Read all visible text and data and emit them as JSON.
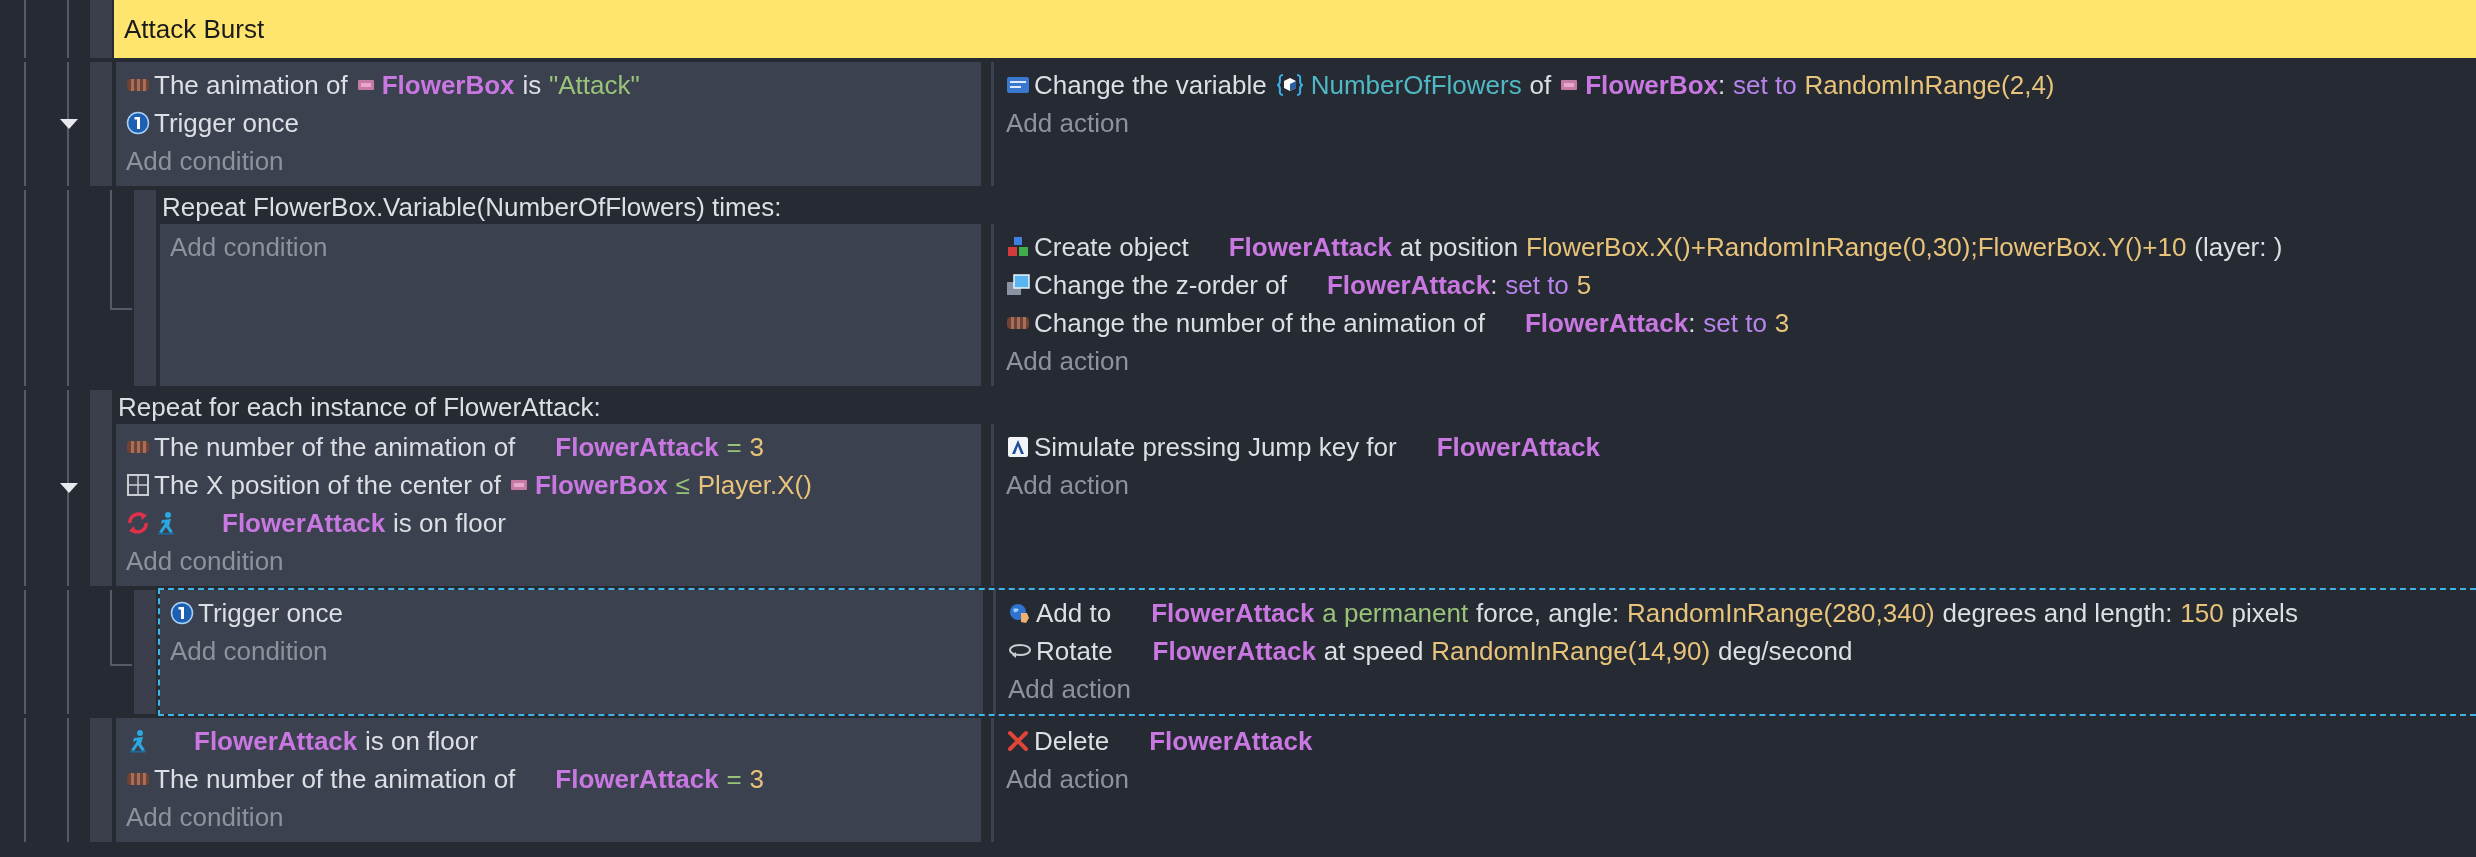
{
  "events": [
    {
      "kind": "group",
      "title": "Attack Burst"
    },
    {
      "kind": "standard",
      "selected": false,
      "expanded": true,
      "conditions": [
        {
          "kind": "animation",
          "inverted": false,
          "runs": [
            {
              "kind": "plain",
              "parts": [
                {
                  "kind": "text",
                  "text": "The animation of"
                }
              ]
            },
            {
              "kind": "thumbnail",
              "parts": [
                {
                  "kind": "object",
                  "text": "FlowerBox"
                },
                {
                  "kind": "text",
                  "text": "is"
                },
                {
                  "kind": "string",
                  "text": "\"Attack\""
                }
              ]
            }
          ]
        },
        {
          "kind": "trigger-once",
          "inverted": false,
          "runs": [
            {
              "kind": "plain",
              "parts": [
                {
                  "kind": "text",
                  "text": "Trigger once"
                }
              ]
            }
          ]
        }
      ],
      "add_condition": "Add condition",
      "actions": [
        {
          "kind": "variable",
          "runs": [
            {
              "kind": "plain",
              "parts": [
                {
                  "kind": "text",
                  "text": "Change the variable"
                }
              ]
            },
            {
              "kind": "variable",
              "parts": [
                {
                  "kind": "variable",
                  "text": "NumberOfFlowers"
                },
                {
                  "kind": "text",
                  "text": "of"
                }
              ]
            },
            {
              "kind": "thumbnail",
              "parts": [
                {
                  "kind": "object",
                  "text": "FlowerBox"
                },
                {
                  "kind": "text",
                  "text": ":",
                  "tight": true
                },
                {
                  "kind": "operator",
                  "text": "set to"
                },
                {
                  "kind": "expression",
                  "text": "RandomInRange(2,4)"
                }
              ]
            }
          ]
        }
      ],
      "add_action": "Add action",
      "children": [
        {
          "kind": "repeat",
          "header": "Repeat FlowerBox.Variable(NumberOfFlowers) times:",
          "selected": false,
          "add_condition": "Add condition",
          "actions": [
            {
              "kind": "create",
              "runs": [
                {
                  "kind": "plain",
                  "parts": [
                    {
                      "kind": "text",
                      "text": "Create object"
                    }
                  ]
                },
                {
                  "kind": "blank",
                  "parts": [
                    {
                      "kind": "object",
                      "text": "FlowerAttack"
                    },
                    {
                      "kind": "text",
                      "text": "at position"
                    },
                    {
                      "kind": "expression",
                      "text": "FlowerBox.X()+RandomInRange(0,30);FlowerBox.Y()+10"
                    },
                    {
                      "kind": "text",
                      "text": "(layer: )"
                    }
                  ]
                }
              ]
            },
            {
              "kind": "z-order",
              "runs": [
                {
                  "kind": "plain",
                  "parts": [
                    {
                      "kind": "text",
                      "text": "Change the z-order of"
                    }
                  ]
                },
                {
                  "kind": "blank",
                  "parts": [
                    {
                      "kind": "object",
                      "text": "FlowerAttack"
                    },
                    {
                      "kind": "text",
                      "text": ":",
                      "tight": true
                    },
                    {
                      "kind": "operator",
                      "text": "set to"
                    },
                    {
                      "kind": "expression",
                      "text": "5"
                    }
                  ]
                }
              ]
            },
            {
              "kind": "animation",
              "runs": [
                {
                  "kind": "plain",
                  "parts": [
                    {
                      "kind": "text",
                      "text": "Change the number of the animation of"
                    }
                  ]
                },
                {
                  "kind": "blank",
                  "parts": [
                    {
                      "kind": "object",
                      "text": "FlowerAttack"
                    },
                    {
                      "kind": "text",
                      "text": ":",
                      "tight": true
                    },
                    {
                      "kind": "operator",
                      "text": "set to"
                    },
                    {
                      "kind": "expression",
                      "text": "3"
                    }
                  ]
                }
              ]
            }
          ],
          "add_action": "Add action"
        }
      ]
    },
    {
      "kind": "for_each",
      "header": "Repeat for each instance of FlowerAttack:",
      "selected": false,
      "expanded": true,
      "conditions": [
        {
          "kind": "animation",
          "inverted": false,
          "runs": [
            {
              "kind": "plain",
              "parts": [
                {
                  "kind": "text",
                  "text": "The number of the animation of"
                }
              ]
            },
            {
              "kind": "blank",
              "parts": [
                {
                  "kind": "object",
                  "text": "FlowerAttack"
                },
                {
                  "kind": "comparison",
                  "text": "="
                },
                {
                  "kind": "expression",
                  "text": "3"
                }
              ]
            }
          ]
        },
        {
          "kind": "position",
          "inverted": false,
          "runs": [
            {
              "kind": "plain",
              "parts": [
                {
                  "kind": "text",
                  "text": "The X position of the center of"
                }
              ]
            },
            {
              "kind": "thumbnail",
              "parts": [
                {
                  "kind": "object",
                  "text": "FlowerBox"
                },
                {
                  "kind": "comparison",
                  "text": "≤"
                },
                {
                  "kind": "expression",
                  "text": "Player.X()"
                }
              ]
            }
          ]
        },
        {
          "kind": "platformer",
          "inverted": true,
          "runs": [
            {
              "kind": "blank",
              "parts": [
                {
                  "kind": "object",
                  "text": "FlowerAttack"
                },
                {
                  "kind": "text",
                  "text": "is on floor"
                }
              ]
            }
          ]
        }
      ],
      "add_condition": "Add condition",
      "actions": [
        {
          "kind": "jump-key",
          "runs": [
            {
              "kind": "plain",
              "parts": [
                {
                  "kind": "text",
                  "text": "Simulate pressing Jump key for"
                }
              ]
            },
            {
              "kind": "blank",
              "parts": [
                {
                  "kind": "object",
                  "text": "FlowerAttack"
                }
              ]
            }
          ]
        }
      ],
      "add_action": "Add action",
      "children": [
        {
          "kind": "standard",
          "selected": true,
          "conditions": [
            {
              "kind": "trigger-once",
              "inverted": false,
              "runs": [
                {
                  "kind": "plain",
                  "parts": [
                    {
                      "kind": "text",
                      "text": "Trigger once"
                    }
                  ]
                }
              ]
            }
          ],
          "add_condition": "Add condition",
          "actions": [
            {
              "kind": "force",
              "runs": [
                {
                  "kind": "plain",
                  "parts": [
                    {
                      "kind": "text",
                      "text": "Add to"
                    }
                  ]
                },
                {
                  "kind": "blank",
                  "parts": [
                    {
                      "kind": "object",
                      "text": "FlowerAttack"
                    },
                    {
                      "kind": "choice",
                      "text": "a permanent"
                    },
                    {
                      "kind": "text",
                      "text": "force, angle:"
                    },
                    {
                      "kind": "expression",
                      "text": "RandomInRange(280,340)"
                    },
                    {
                      "kind": "text",
                      "text": "degrees and length:"
                    },
                    {
                      "kind": "expression",
                      "text": "150"
                    },
                    {
                      "kind": "text",
                      "text": "pixels"
                    }
                  ]
                }
              ]
            },
            {
              "kind": "rotate",
              "runs": [
                {
                  "kind": "plain",
                  "parts": [
                    {
                      "kind": "text",
                      "text": "Rotate"
                    }
                  ]
                },
                {
                  "kind": "blank",
                  "parts": [
                    {
                      "kind": "object",
                      "text": "FlowerAttack"
                    },
                    {
                      "kind": "text",
                      "text": "at speed"
                    },
                    {
                      "kind": "expression",
                      "text": "RandomInRange(14,90)"
                    },
                    {
                      "kind": "text",
                      "text": "deg/second"
                    }
                  ]
                }
              ]
            }
          ],
          "add_action": "Add action"
        }
      ]
    },
    {
      "kind": "standard",
      "selected": false,
      "conditions": [
        {
          "kind": "platformer",
          "inverted": false,
          "runs": [
            {
              "kind": "blank",
              "parts": [
                {
                  "kind": "object",
                  "text": "FlowerAttack"
                },
                {
                  "kind": "text",
                  "text": "is on floor"
                }
              ]
            }
          ]
        },
        {
          "kind": "animation",
          "inverted": false,
          "runs": [
            {
              "kind": "plain",
              "parts": [
                {
                  "kind": "text",
                  "text": "The number of the animation of"
                }
              ]
            },
            {
              "kind": "blank",
              "parts": [
                {
                  "kind": "object",
                  "text": "FlowerAttack"
                },
                {
                  "kind": "comparison",
                  "text": "="
                },
                {
                  "kind": "expression",
                  "text": "3"
                }
              ]
            }
          ]
        }
      ],
      "add_condition": "Add condition",
      "actions": [
        {
          "kind": "delete",
          "runs": [
            {
              "kind": "plain",
              "parts": [
                {
                  "kind": "text",
                  "text": "Delete"
                }
              ]
            },
            {
              "kind": "blank",
              "parts": [
                {
                  "kind": "object",
                  "text": "FlowerAttack"
                }
              ]
            }
          ]
        }
      ],
      "add_action": "Add action"
    }
  ]
}
